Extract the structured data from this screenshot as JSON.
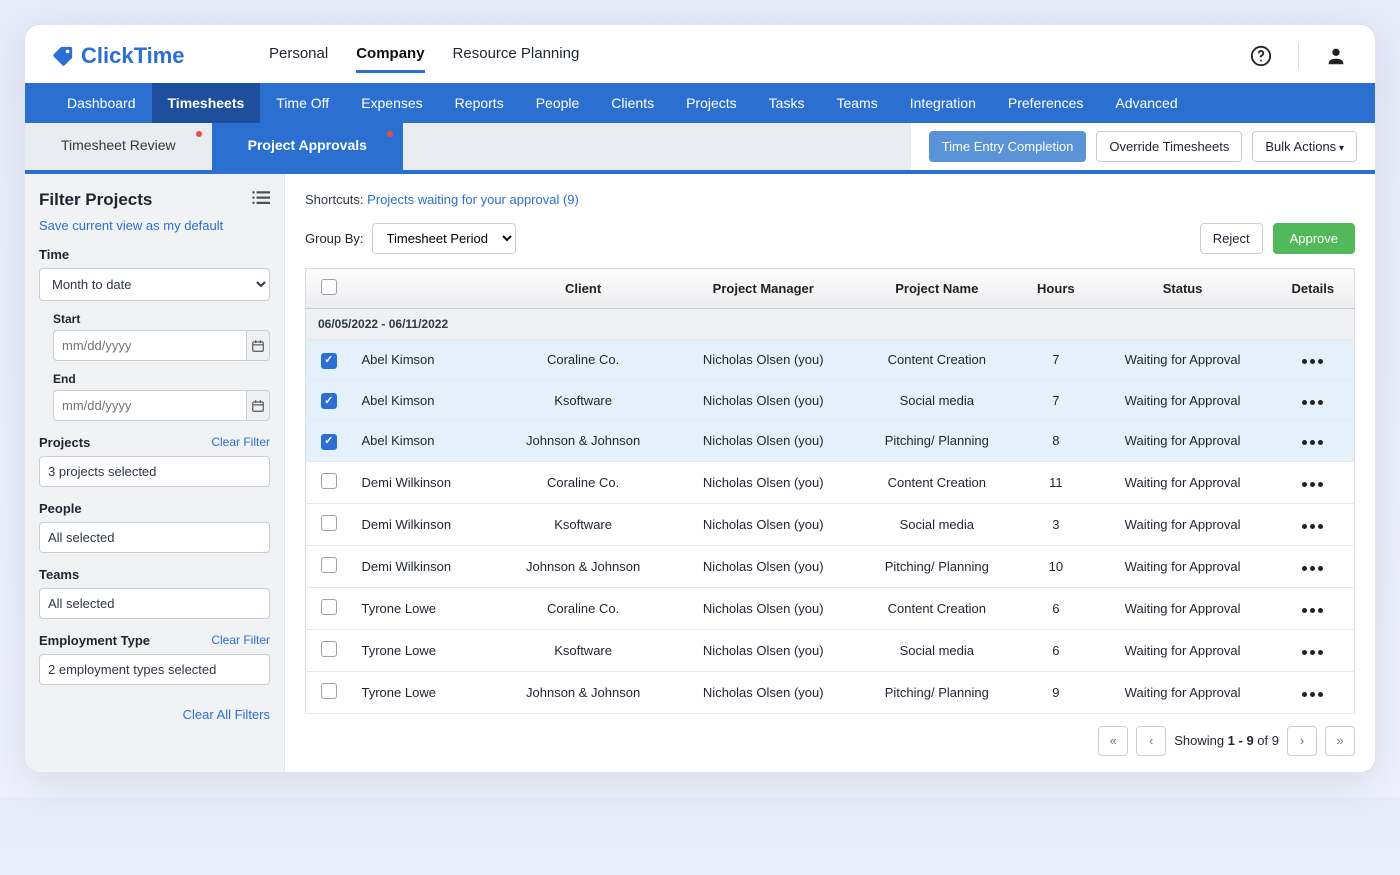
{
  "brand": {
    "name": "ClickTime"
  },
  "topnav": {
    "items": [
      "Personal",
      "Company",
      "Resource Planning"
    ],
    "active": "Company"
  },
  "ribbon": {
    "items": [
      "Dashboard",
      "Timesheets",
      "Time Off",
      "Expenses",
      "Reports",
      "People",
      "Clients",
      "Projects",
      "Tasks",
      "Teams",
      "Integration",
      "Preferences",
      "Advanced"
    ],
    "active": "Timesheets"
  },
  "subtabs": {
    "items": [
      "Timesheet Review",
      "Project Approvals"
    ],
    "active": "Project Approvals",
    "buttons": {
      "time_entry": "Time Entry Completion",
      "override": "Override Timesheets",
      "bulk": "Bulk Actions"
    }
  },
  "sidebar": {
    "title": "Filter Projects",
    "save_link": "Save current view as my default",
    "time_label": "Time",
    "time_value": "Month to date",
    "start_label": "Start",
    "end_label": "End",
    "date_placeholder": "mm/dd/yyyy",
    "projects_label": "Projects",
    "projects_value": "3 projects selected",
    "people_label": "People",
    "people_value": "All selected",
    "teams_label": "Teams",
    "teams_value": "All selected",
    "emp_label": "Employment Type",
    "emp_value": "2 employment types selected",
    "clear_filter": "Clear Filter",
    "clear_all": "Clear All Filters"
  },
  "main": {
    "shortcuts_label": "Shortcuts:",
    "shortcuts_link": "Projects waiting for your approval (9)",
    "group_by_label": "Group By:",
    "group_by_value": "Timesheet Period",
    "reject": "Reject",
    "approve": "Approve",
    "columns": [
      "",
      "",
      "Client",
      "Project Manager",
      "Project Name",
      "Hours",
      "Status",
      "Details"
    ],
    "group_header": "06/05/2022 - 06/11/2022",
    "rows": [
      {
        "selected": true,
        "person": "Abel Kimson",
        "client": "Coraline Co.",
        "pm": "Nicholas Olsen (you)",
        "project": "Content Creation",
        "hours": "7",
        "status": "Waiting for Approval"
      },
      {
        "selected": true,
        "person": "Abel Kimson",
        "client": "Ksoftware",
        "pm": "Nicholas Olsen (you)",
        "project": "Social media",
        "hours": "7",
        "status": "Waiting for Approval"
      },
      {
        "selected": true,
        "person": "Abel Kimson",
        "client": "Johnson & Johnson",
        "pm": "Nicholas Olsen (you)",
        "project": "Pitching/ Planning",
        "hours": "8",
        "status": "Waiting for Approval"
      },
      {
        "selected": false,
        "person": "Demi Wilkinson",
        "client": "Coraline Co.",
        "pm": "Nicholas Olsen (you)",
        "project": "Content Creation",
        "hours": "11",
        "status": "Waiting for Approval"
      },
      {
        "selected": false,
        "person": "Demi Wilkinson",
        "client": "Ksoftware",
        "pm": "Nicholas Olsen (you)",
        "project": "Social media",
        "hours": "3",
        "status": "Waiting for Approval"
      },
      {
        "selected": false,
        "person": "Demi Wilkinson",
        "client": "Johnson & Johnson",
        "pm": "Nicholas Olsen (you)",
        "project": "Pitching/ Planning",
        "hours": "10",
        "status": "Waiting for Approval"
      },
      {
        "selected": false,
        "person": "Tyrone Lowe",
        "client": "Coraline Co.",
        "pm": "Nicholas Olsen (you)",
        "project": "Content Creation",
        "hours": "6",
        "status": "Waiting for Approval"
      },
      {
        "selected": false,
        "person": "Tyrone Lowe",
        "client": "Ksoftware",
        "pm": "Nicholas Olsen (you)",
        "project": "Social media",
        "hours": "6",
        "status": "Waiting for Approval"
      },
      {
        "selected": false,
        "person": "Tyrone Lowe",
        "client": "Johnson & Johnson",
        "pm": "Nicholas Olsen (you)",
        "project": "Pitching/ Planning",
        "hours": "9",
        "status": "Waiting for Approval"
      }
    ],
    "pager": {
      "text_prefix": "Showing ",
      "range": "1 - 9",
      "of_label": " of ",
      "total": "9"
    }
  }
}
